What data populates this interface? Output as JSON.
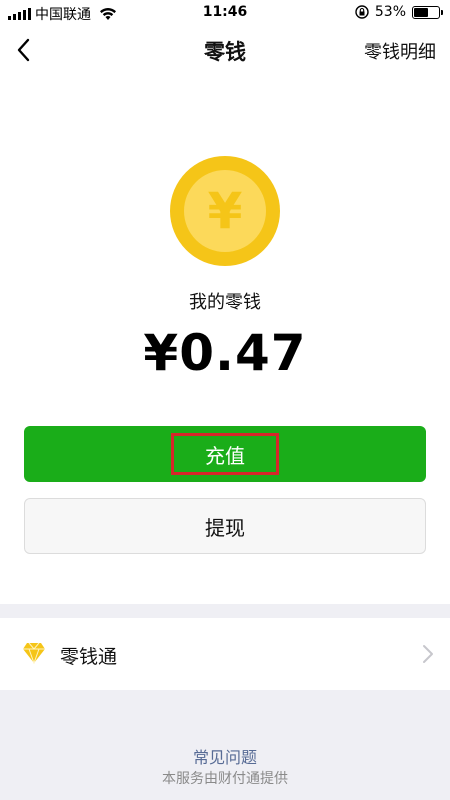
{
  "status_bar": {
    "carrier": "中国联通",
    "time": "11:46",
    "battery_percent": "53%",
    "battery_level": 0.53
  },
  "nav": {
    "title": "零钱",
    "detail_link": "零钱明细"
  },
  "wallet": {
    "label": "我的零钱",
    "amount": "¥0.47",
    "coin_symbol": "¥"
  },
  "actions": {
    "recharge_label": "充值",
    "withdraw_label": "提现"
  },
  "lingqiantong": {
    "label": "零钱通"
  },
  "footer": {
    "faq": "常见问题",
    "provider": "本服务由财付通提供"
  },
  "colors": {
    "primary_green": "#1aad19",
    "coin_outer": "#f5c518",
    "coin_inner": "#fcd95a",
    "highlight_red": "#d6262a",
    "link_blue": "#576b95"
  }
}
